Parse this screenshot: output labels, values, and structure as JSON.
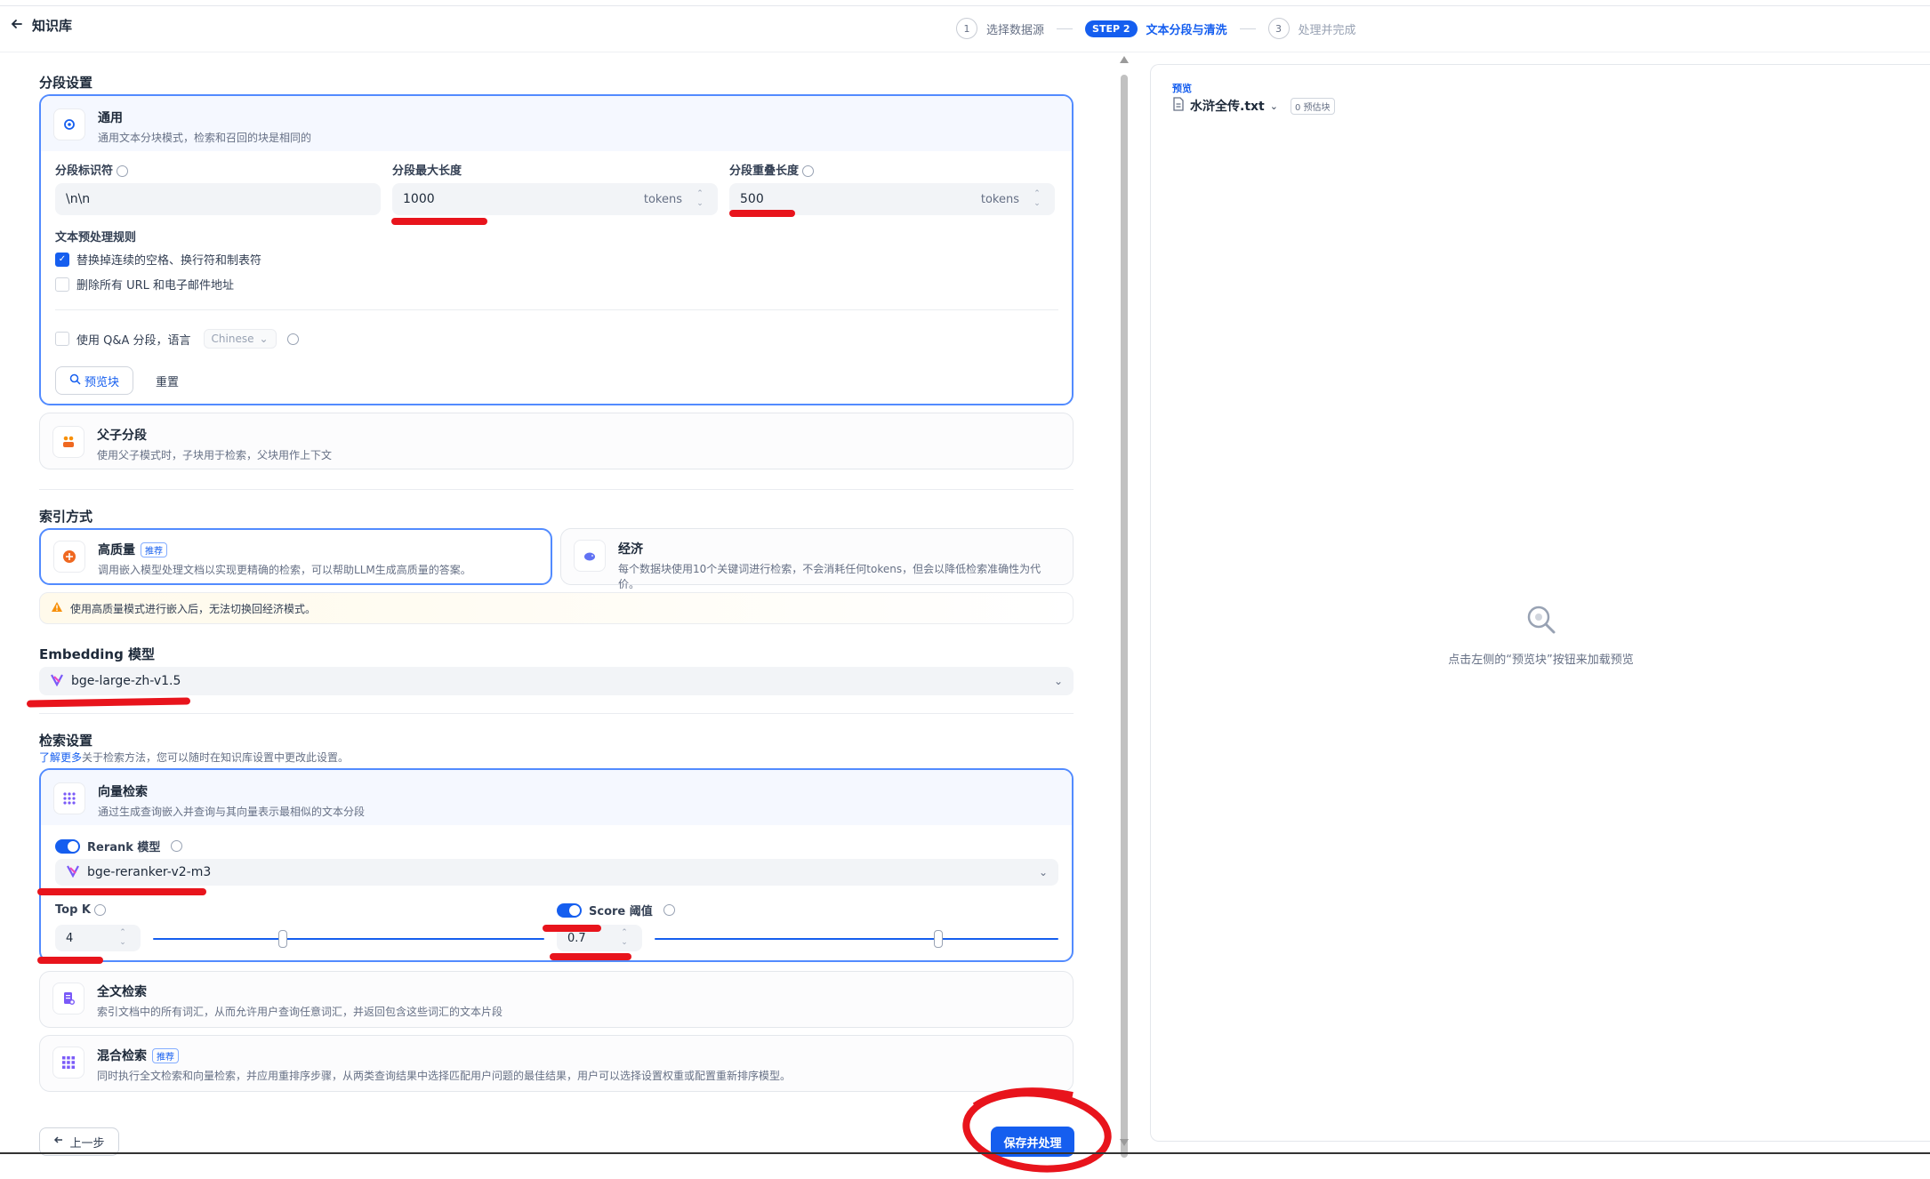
{
  "header": {
    "back_label": "知识库",
    "steps": [
      {
        "num": "1",
        "label": "选择数据源"
      },
      {
        "num": "STEP 2",
        "label": "文本分段与清洗"
      },
      {
        "num": "3",
        "label": "处理并完成"
      }
    ]
  },
  "segment": {
    "section_title": "分段设置",
    "general": {
      "title": "通用",
      "desc": "通用文本分块模式，检索和召回的块是相同的",
      "separator_label": "分段标识符",
      "separator_value": "\\n\\n",
      "max_length_label": "分段最大长度",
      "max_length_value": "1000",
      "overlap_label": "分段重叠长度",
      "overlap_value": "500",
      "unit": "tokens",
      "rules_label": "文本预处理规则",
      "rule1": "替换掉连续的空格、换行符和制表符",
      "rule1_checked": true,
      "rule2": "删除所有 URL 和电子邮件地址",
      "rule2_checked": false,
      "qa_label": "使用 Q&A 分段，语言",
      "qa_language": "Chinese",
      "preview_button": "预览块",
      "reset_button": "重置"
    },
    "parent_child": {
      "title": "父子分段",
      "desc": "使用父子模式时，子块用于检索，父块用作上下文"
    }
  },
  "index": {
    "section_title": "索引方式",
    "high_quality": {
      "title": "高质量",
      "badge": "推荐",
      "desc": "调用嵌入模型处理文档以实现更精确的检索，可以帮助LLM生成高质量的答案。"
    },
    "economy": {
      "title": "经济",
      "desc": "每个数据块使用10个关键词进行检索，不会消耗任何tokens，但会以降低检索准确性为代价。"
    },
    "warning": "使用高质量模式进行嵌入后，无法切换回经济模式。"
  },
  "embedding": {
    "section_title": "Embedding 模型",
    "model": "bge-large-zh-v1.5"
  },
  "retrieval": {
    "section_title": "检索设置",
    "learn_more": "了解更多",
    "note": "关于检索方法，您可以随时在知识库设置中更改此设置。",
    "vector": {
      "title": "向量检索",
      "desc": "通过生成查询嵌入并查询与其向量表示最相似的文本分段",
      "rerank_label": "Rerank 模型",
      "rerank_model": "bge-reranker-v2-m3",
      "topk_label": "Top K",
      "topk_value": "4",
      "topk_fraction": 0.33,
      "score_label": "Score 阈值",
      "score_value": "0.7",
      "score_fraction": 0.7
    },
    "fulltext": {
      "title": "全文检索",
      "desc": "索引文档中的所有词汇，从而允许用户查询任意词汇，并返回包含这些词汇的文本片段"
    },
    "hybrid": {
      "title": "混合检索",
      "badge": "推荐",
      "desc": "同时执行全文检索和向量检索，并应用重排序步骤，从两类查询结果中选择匹配用户问题的最佳结果，用户可以选择设置权重或配置重新排序模型。"
    }
  },
  "footer": {
    "prev_button": "上一步",
    "save_button": "保存并处理"
  },
  "preview": {
    "label": "预览",
    "file_name": "水浒全传.txt",
    "count_badge": "0 预估块",
    "empty_hint": "点击左侧的“预览块”按钮来加载预览"
  },
  "colors": {
    "accent": "#155eef",
    "annotation": "#e8141c"
  }
}
